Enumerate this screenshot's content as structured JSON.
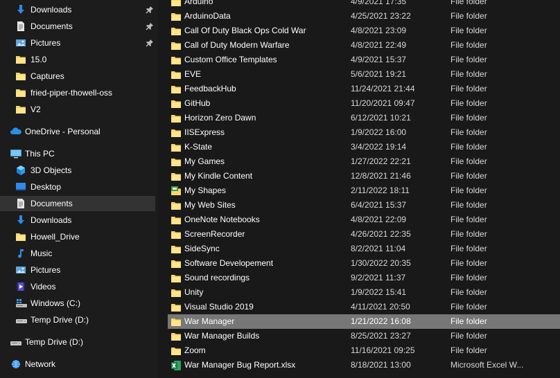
{
  "sidebar": {
    "quick_access": [
      {
        "label": "Downloads",
        "icon": "download-arrow-icon",
        "pinned": true
      },
      {
        "label": "Documents",
        "icon": "document-icon",
        "pinned": true
      },
      {
        "label": "Pictures",
        "icon": "pictures-icon",
        "pinned": true
      },
      {
        "label": "15.0",
        "icon": "folder-icon"
      },
      {
        "label": "Captures",
        "icon": "folder-icon"
      },
      {
        "label": "fried-piper-thowell-oss",
        "icon": "folder-icon"
      },
      {
        "label": "V2",
        "icon": "folder-icon"
      }
    ],
    "onedrive": {
      "label": "OneDrive - Personal",
      "icon": "cloud-icon"
    },
    "this_pc": {
      "label": "This PC",
      "icon": "monitor-icon"
    },
    "pc_items": [
      {
        "label": "3D Objects",
        "icon": "cube-icon"
      },
      {
        "label": "Desktop",
        "icon": "desktop-icon"
      },
      {
        "label": "Documents",
        "icon": "document-icon",
        "selected": true
      },
      {
        "label": "Downloads",
        "icon": "download-arrow-icon"
      },
      {
        "label": "Howell_Drive",
        "icon": "folder-icon"
      },
      {
        "label": "Music",
        "icon": "music-note-icon"
      },
      {
        "label": "Pictures",
        "icon": "pictures-icon"
      },
      {
        "label": "Videos",
        "icon": "film-icon"
      },
      {
        "label": "Windows (C:)",
        "icon": "windows-drive-icon"
      },
      {
        "label": "Temp Drive (D:)",
        "icon": "drive-icon"
      }
    ],
    "drive": {
      "label": "Temp Drive (D:)",
      "icon": "drive-icon"
    },
    "network": {
      "label": "Network",
      "icon": "network-icon"
    }
  },
  "files": [
    {
      "name": "Arduino",
      "date": "4/9/2021 17:35",
      "type": "File folder",
      "icon": "folder-icon"
    },
    {
      "name": "ArduinoData",
      "date": "4/25/2021 23:22",
      "type": "File folder",
      "icon": "folder-icon"
    },
    {
      "name": "Call Of Duty Black Ops Cold War",
      "date": "4/8/2021 23:09",
      "type": "File folder",
      "icon": "folder-icon"
    },
    {
      "name": "Call of Duty Modern Warfare",
      "date": "4/8/2021 22:49",
      "type": "File folder",
      "icon": "folder-icon"
    },
    {
      "name": "Custom Office Templates",
      "date": "4/9/2021 15:37",
      "type": "File folder",
      "icon": "folder-icon"
    },
    {
      "name": "EVE",
      "date": "5/6/2021 19:21",
      "type": "File folder",
      "icon": "folder-icon"
    },
    {
      "name": "FeedbackHub",
      "date": "11/24/2021 21:44",
      "type": "File folder",
      "icon": "folder-icon"
    },
    {
      "name": "GitHub",
      "date": "11/20/2021 09:47",
      "type": "File folder",
      "icon": "folder-icon"
    },
    {
      "name": "Horizon Zero Dawn",
      "date": "6/12/2021 10:21",
      "type": "File folder",
      "icon": "folder-icon"
    },
    {
      "name": "IISExpress",
      "date": "1/9/2022 16:00",
      "type": "File folder",
      "icon": "folder-icon"
    },
    {
      "name": "K-State",
      "date": "3/4/2022 19:14",
      "type": "File folder",
      "icon": "folder-icon"
    },
    {
      "name": "My Games",
      "date": "1/27/2022 22:21",
      "type": "File folder",
      "icon": "folder-icon"
    },
    {
      "name": "My Kindle Content",
      "date": "12/8/2021 21:46",
      "type": "File folder",
      "icon": "folder-icon"
    },
    {
      "name": "My Shapes",
      "date": "2/11/2022 18:11",
      "type": "File folder",
      "icon": "shapes-folder-icon"
    },
    {
      "name": "My Web Sites",
      "date": "6/4/2021 15:37",
      "type": "File folder",
      "icon": "folder-icon"
    },
    {
      "name": "OneNote Notebooks",
      "date": "4/8/2021 22:09",
      "type": "File folder",
      "icon": "folder-icon"
    },
    {
      "name": "ScreenRecorder",
      "date": "4/26/2021 22:35",
      "type": "File folder",
      "icon": "folder-icon"
    },
    {
      "name": "SideSync",
      "date": "8/2/2021 11:04",
      "type": "File folder",
      "icon": "folder-icon"
    },
    {
      "name": "Software Developement",
      "date": "1/30/2022 20:35",
      "type": "File folder",
      "icon": "folder-icon"
    },
    {
      "name": "Sound recordings",
      "date": "9/2/2021 11:37",
      "type": "File folder",
      "icon": "folder-icon"
    },
    {
      "name": "Unity",
      "date": "1/9/2022 15:41",
      "type": "File folder",
      "icon": "folder-icon"
    },
    {
      "name": "Visual Studio 2019",
      "date": "4/11/2021 20:50",
      "type": "File folder",
      "icon": "folder-icon"
    },
    {
      "name": "War Manager",
      "date": "1/21/2022 16:08",
      "type": "File folder",
      "icon": "folder-icon",
      "selected": true
    },
    {
      "name": "War Manager Builds",
      "date": "8/25/2021 23:27",
      "type": "File folder",
      "icon": "folder-icon"
    },
    {
      "name": "Zoom",
      "date": "11/16/2021 09:25",
      "type": "File folder",
      "icon": "folder-icon"
    },
    {
      "name": "War Manager Bug Report.xlsx",
      "date": "8/18/2021 13:00",
      "type": "Microsoft Excel W...",
      "icon": "excel-file-icon"
    }
  ],
  "colors": {
    "folder": "#f7d56b",
    "download_arrow": "#2f8ae8",
    "onedrive": "#2a8fe6",
    "excel": "#1d7a45",
    "selected_nav": "#333333",
    "selected_row": "#777777"
  }
}
